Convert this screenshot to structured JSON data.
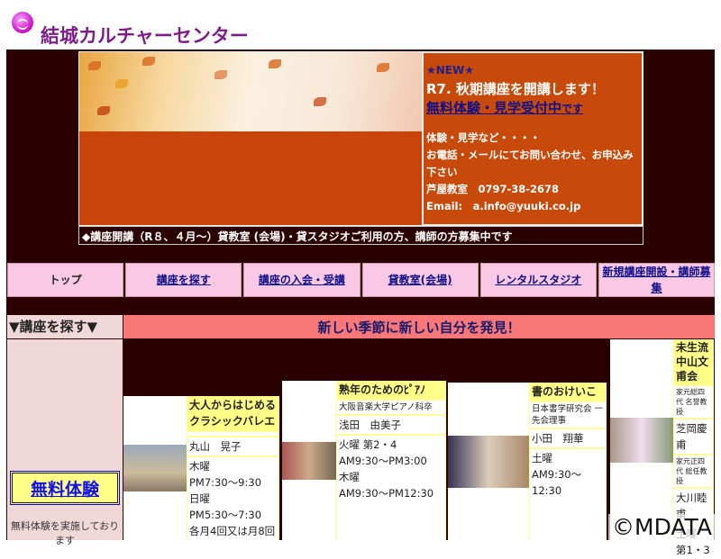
{
  "header": {
    "title": "結城カルチャーセンター"
  },
  "news": {
    "new_label": "★NEW★",
    "headline": "R7. 秋期講座を開講します！",
    "link": "無料体験・見学受付中",
    "link_suffix": "です",
    "line1": "体験・見学など・・・・",
    "line2": "お電話・メールにてお問い合わせ、お申込み下さい",
    "phone_label": "芦屋教室　0797-38-2678",
    "email": "Email:　a.info@yuuki.co.jp"
  },
  "strip": "◆講座開講（R８、４月～）貸教室 (会場)・貸スタジオご利用の方、講師の方募集中です",
  "nav": [
    "トップ",
    "講座を探す",
    "講座の入会・受講",
    "貸教室(会場)",
    "レンタルスタジオ",
    "新規講座開設・講師募集"
  ],
  "section": {
    "left": "▼講座を探す▼",
    "right": "新しい季節に新しい自分を発見！"
  },
  "sidebar": {
    "free_button": "無料体験",
    "free_text": "無料体験を実施しております"
  },
  "courses": [
    {
      "title": "大人からはじめるクラシックバレエ",
      "note": "",
      "teacher": "丸山　晃子",
      "schedule": [
        "木曜",
        "PM7:30～9:30",
        "日曜",
        "PM5:30～7:30",
        "各月4回又は月8回"
      ]
    },
    {
      "title": "熟年のためのﾋﾟｱﾉ",
      "note": "大阪音楽大学ピアノ科卒",
      "teacher": "浅田　由美子",
      "schedule": [
        "火曜 第2・4",
        "AM9:30～PM3:00",
        "木曜",
        "AM9:30～PM12:30"
      ]
    },
    {
      "title": "書のおけいこ",
      "note": "日本書学研究会 一先会理事",
      "teacher": "小田　翔華",
      "schedule": [
        "土曜",
        "AM9:30～12:30"
      ]
    },
    {
      "title": "未生流中山文甫会",
      "note": "家元総四代 名誉教授",
      "teacher": "芝岡慶甫",
      "note2": "家元正四代 総任教授",
      "teacher2": "大川睦甫",
      "schedule": [
        "土曜",
        "第1・3"
      ]
    }
  ],
  "watermark": "©MDATA"
}
